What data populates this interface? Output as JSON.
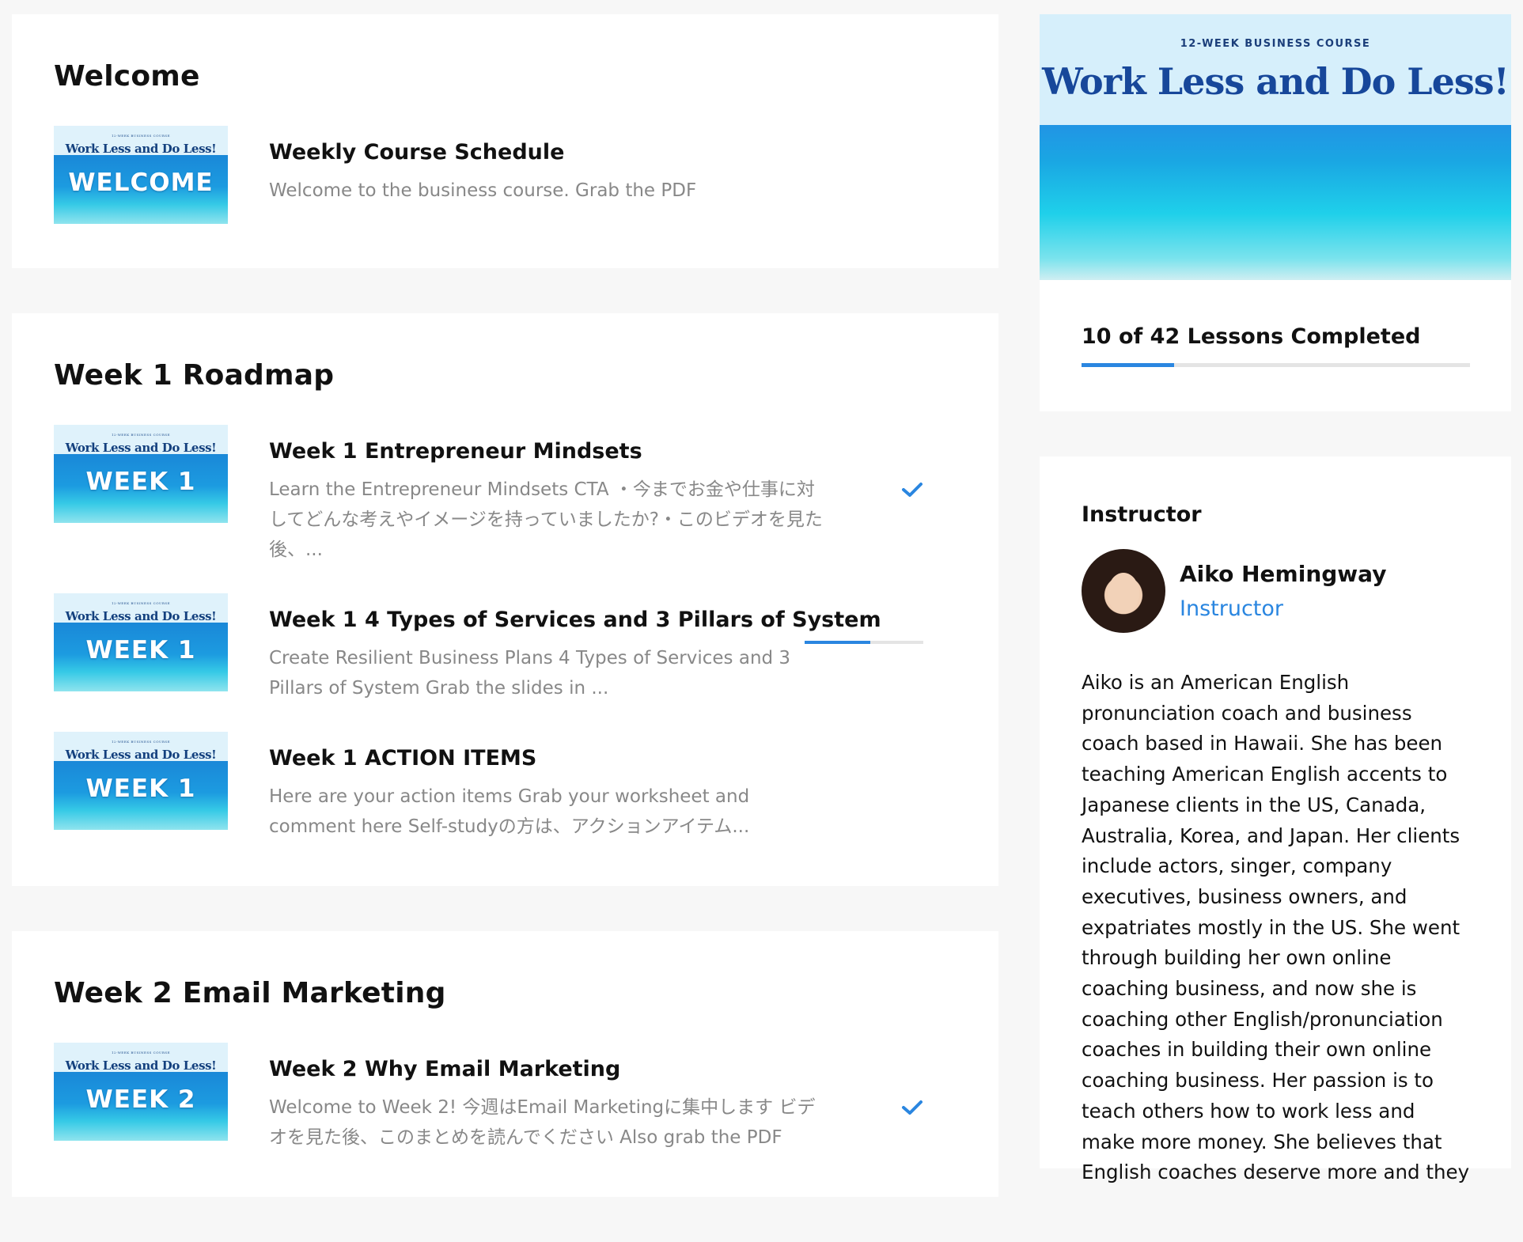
{
  "sections": [
    {
      "title": "Welcome",
      "lessons": [
        {
          "title": "Weekly Course Schedule",
          "desc": "Welcome to the business course. Grab the PDF",
          "thumb_small": "12-WEEK BUSINESS COURSE",
          "thumb_title": "Work Less and Do Less!",
          "thumb_label": "WELCOME",
          "status": "none"
        }
      ]
    },
    {
      "title": "Week 1 Roadmap",
      "lessons": [
        {
          "title": "Week 1 Entrepreneur Mindsets",
          "desc": "Learn the Entrepreneur Mindsets CTA ・今までお金や仕事に対してどんな考えやイメージを持っていましたか?・このビデオを見た後、...",
          "thumb_small": "12-WEEK BUSINESS COURSE",
          "thumb_title": "Work Less and Do Less!",
          "thumb_label": "WEEK 1",
          "status": "complete"
        },
        {
          "title": "Week 1 4 Types of Services and 3 Pillars of System",
          "desc": "Create Resilient Business Plans 4 Types of Services and 3 Pillars of System Grab the slides in ...",
          "thumb_small": "12-WEEK BUSINESS COURSE",
          "thumb_title": "Work Less and Do Less!",
          "thumb_label": "WEEK 1",
          "status": "in-progress",
          "progress": 0.55
        },
        {
          "title": "Week 1 ACTION ITEMS",
          "desc": "Here are your action items Grab your worksheet and comment here   Self-studyの方は、アクションアイテム...",
          "thumb_small": "12-WEEK BUSINESS COURSE",
          "thumb_title": "Work Less and Do Less!",
          "thumb_label": "WEEK 1",
          "status": "none"
        }
      ]
    },
    {
      "title": "Week 2 Email Marketing",
      "lessons": [
        {
          "title": "Week 2 Why Email Marketing",
          "desc": "Welcome to Week 2! 今週はEmail Marketingに集中します ビデオを見た後、このまとめを読んでください Also grab the PDF",
          "thumb_small": "12-WEEK BUSINESS COURSE",
          "thumb_title": "Work Less and Do Less!",
          "thumb_label": "WEEK 2",
          "status": "complete"
        }
      ]
    }
  ],
  "course": {
    "banner_small": "12-WEEK BUSINESS COURSE",
    "banner_title": "Work Less and Do Less!",
    "progress_text": "10 of 42 Lessons Completed",
    "completed": 10,
    "total": 42
  },
  "instructor": {
    "heading": "Instructor",
    "name": "Aiko Hemingway",
    "role": "Instructor",
    "bio": "Aiko is an American English pronunciation coach and business coach based in Hawaii. She has been teaching American English accents to Japanese clients in the US, Canada, Australia, Korea, and Japan. Her clients include actors, singer, company executives, business owners, and expatriates mostly in the US. She went through building her own online coaching business, and now she is coaching other English/pronunciation coaches in building their own online coaching business. Her passion is to teach others how to work less and make more money. She believes that English coaches deserve more and they"
  },
  "colors": {
    "accent": "#2a86e0",
    "background": "#f7f7f7",
    "muted_text": "#888888"
  }
}
